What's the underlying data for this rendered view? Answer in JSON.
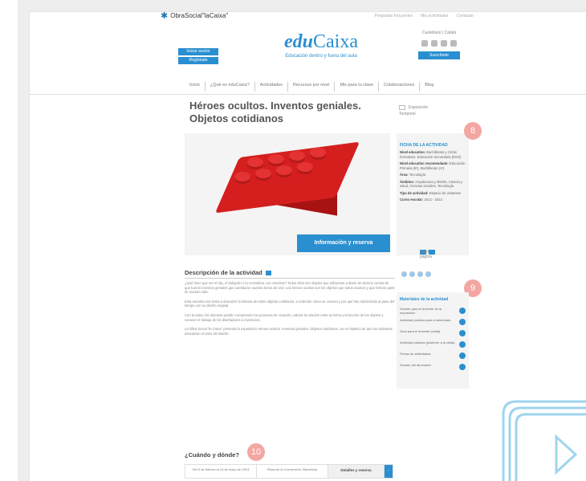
{
  "topbar": {
    "logo": "ObraSocial\"laCaixa\"",
    "links": [
      "Preguntas frecuentes",
      "Mis actividades",
      "Contactar"
    ]
  },
  "header": {
    "login_label": "Iniciar sesión",
    "register_label": "Regístrate",
    "brand_prefix": "edu",
    "brand_suffix": "Caixa",
    "tagline": "Educación dentro y fuera del aula",
    "language": "Castellano | Català",
    "subscribe_label": "Suscríbete"
  },
  "nav": [
    "Inicio",
    "¿Qué es eduCaixa?",
    "Actividades",
    "Recursos por nivel",
    "Mis para tu clase",
    "Colaboraciones",
    "Blog"
  ],
  "page": {
    "title": "Héroes ocultos. Inventos geniales. Objetos cotidianos",
    "side_share": [
      "Exposición",
      "Temporal"
    ],
    "info_button": "Información y reserva",
    "print_label": "Imprimir página"
  },
  "ficha": {
    "title": "FICHA DE LA ACTIVIDAD",
    "rows": [
      {
        "label": "Nivel educativo:",
        "value": "Bachillerato y Ciclos formativos, Educación Secundaria (ESO)"
      },
      {
        "label": "Nivel educativo recomendado:",
        "value": "Educación Primaria (6º), Bachillerato (1º)"
      },
      {
        "label": "Área:",
        "value": "Tecnología"
      },
      {
        "label": "Ámbitos:",
        "value": "Arquitectura y diseño, Ciencia y salud, Ciencias sociales, Tecnología"
      },
      {
        "label": "Tipo de actividad:",
        "value": "Espacio de visitantes"
      },
      {
        "label": "Curso escolar:",
        "value": "2012 - 2013"
      }
    ]
  },
  "badges": [
    "8",
    "9",
    "10"
  ],
  "description": {
    "title": "Descripción de la actividad",
    "paragraphs": [
      "¿Qué tiene que ver el clip, el bolígrafo o la cremallera con nosotros? Todos ellos son objetos que utilizamos a diario sin darnos cuenta de que fueron inventos geniales que cambiaron nuestra forma de vivir. Los héroes ocultos son los objetos que todos usamos y que forman parte de nuestra vida.",
      "Esta muestra nos invita a descubrir la historia de estos objetos cotidianos, a entender cómo se crearon y por qué han sobrevivido al paso del tiempo con su diseño original.",
      "Con la visita, los alumnos podrán comprender los procesos de creación, valorar la relación entre la forma y la función de los objetos y conocer el trabajo de los diseñadores e inventores.",
      "La Obra Social \"la Caixa\" presenta la exposición Héroes ocultos. Inventos geniales. Objetos cotidianos, con el objetivo de que los visitantes descubran el valor del diseño."
    ]
  },
  "materials": {
    "title": "Materiales de la actividad",
    "items": [
      "Dossier para el docente de la exposición",
      "Actividad práctica para el alumnado",
      "Guía para el docente (visita)",
      "Actividad práctica (posterior a la visita)",
      "Fichas de actividades",
      "Dossier del alumnado"
    ]
  },
  "when": {
    "title": "¿Cuándo y dónde?",
    "cells": [
      "Del 9 de febrero al 14 de mayo de 2013",
      "Plaza de la Convención, Barcelona"
    ],
    "reserve_label": "Detalles y reserva",
    "arrow": "›"
  }
}
